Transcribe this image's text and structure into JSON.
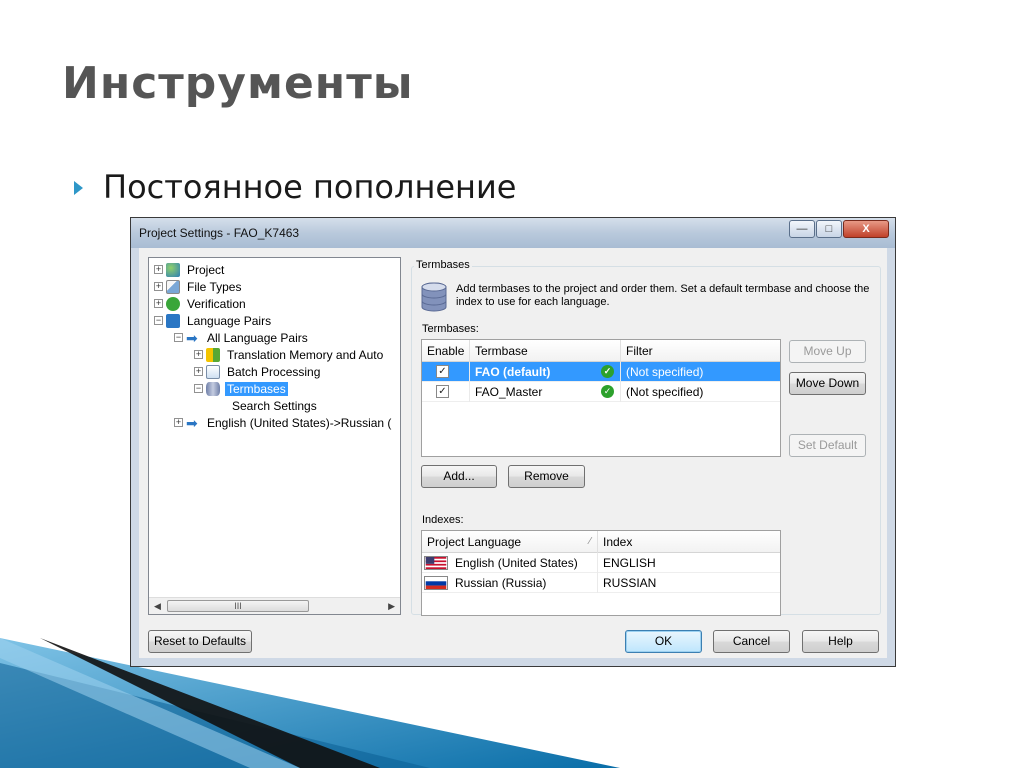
{
  "slide": {
    "title": "Инструменты",
    "bullet": "Постоянное пополнение"
  },
  "dialog": {
    "title": "Project Settings - FAO_K7463",
    "window_buttons": {
      "minimize": "—",
      "maximize": "□",
      "close": "X"
    },
    "tree": {
      "items": [
        {
          "label": "Project",
          "icon": "globe-icon"
        },
        {
          "label": "File Types",
          "icon": "file-types-icon"
        },
        {
          "label": "Verification",
          "icon": "verification-icon"
        },
        {
          "label": "Language Pairs",
          "icon": "language-pairs-icon"
        },
        {
          "label": "All Language Pairs",
          "icon": "arrow-right-icon"
        },
        {
          "label": "Translation Memory and Auto",
          "icon": "translation-memory-icon"
        },
        {
          "label": "Batch Processing",
          "icon": "batch-processing-icon"
        },
        {
          "label": "Termbases",
          "icon": "termbase-icon"
        },
        {
          "label": "Search Settings",
          "icon": ""
        },
        {
          "label": "English (United States)->Russian (",
          "icon": "arrow-right-icon"
        }
      ],
      "scroll_thumb": "III"
    },
    "termbases_group": {
      "label": "Termbases",
      "description": "Add termbases to the project and order them. Set a default termbase and choose the index to use for each language.",
      "list_label": "Termbases:",
      "columns": [
        "Enable",
        "Termbase",
        "Filter"
      ],
      "rows": [
        {
          "enabled": "✓",
          "name": "FAO (default)",
          "filter": "(Not specified)",
          "selected": true
        },
        {
          "enabled": "✓",
          "name": "FAO_Master",
          "filter": "(Not specified)",
          "selected": false
        }
      ],
      "move_up": "Move Up",
      "move_down": "Move Down",
      "set_default": "Set Default",
      "add": "Add...",
      "remove": "Remove",
      "indexes_label": "Indexes:",
      "index_columns": [
        "Project Language",
        "Index"
      ],
      "index_rows": [
        {
          "language": "English (United States)",
          "index": "ENGLISH",
          "flag": "us-flag-icon"
        },
        {
          "language": "Russian (Russia)",
          "index": "RUSSIAN",
          "flag": "ru-flag-icon"
        }
      ]
    },
    "footer": {
      "reset": "Reset to Defaults",
      "ok": "OK",
      "cancel": "Cancel",
      "help": "Help"
    }
  },
  "colors": {
    "selection": "#3399ff",
    "bullet_accent": "#2e97c8",
    "deco_blue": "#0a6ea8"
  }
}
